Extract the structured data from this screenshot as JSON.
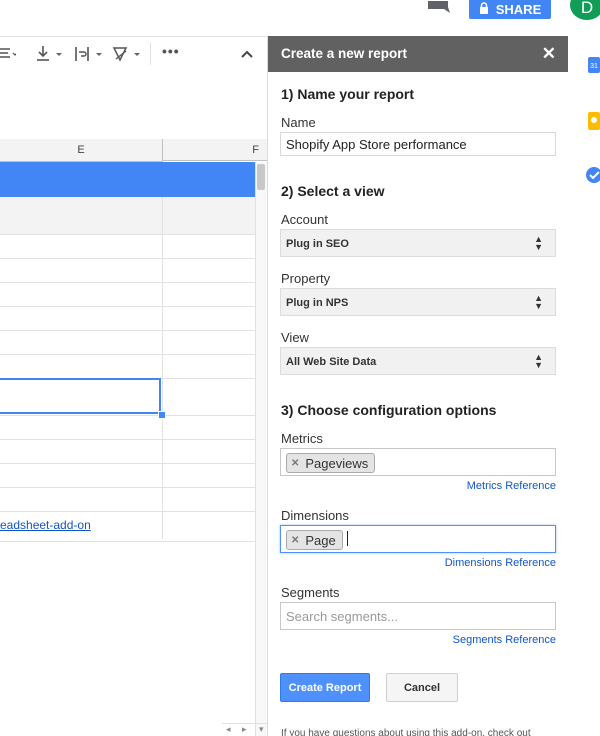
{
  "topbar": {
    "share_label": "SHARE",
    "avatar_initial": "D"
  },
  "grid": {
    "columns": [
      "E",
      "F"
    ],
    "link_text": "eadsheet-add-on"
  },
  "panel": {
    "title": "Create a new report",
    "section1": "1) Name your report",
    "name_label": "Name",
    "name_value": "Shopify App Store performance",
    "section2": "2) Select a view",
    "account_label": "Account",
    "account_value": "Plug in SEO",
    "property_label": "Property",
    "property_value": "Plug in NPS",
    "view_label": "View",
    "view_value": "All Web Site Data",
    "section3": "3) Choose configuration options",
    "metrics_label": "Metrics",
    "metrics_chip": "Pageviews",
    "metrics_ref": "Metrics Reference",
    "dimensions_label": "Dimensions",
    "dimensions_chip": "Page",
    "dimensions_ref": "Dimensions Reference",
    "segments_label": "Segments",
    "segments_placeholder": "Search segments...",
    "segments_ref": "Segments Reference",
    "create_button": "Create Report",
    "cancel_button": "Cancel",
    "footer_note": "If you have questions about using this add-on, check out"
  },
  "colors": {
    "accent": "#4285f4",
    "panel_header": "#616161",
    "link": "#1155cc",
    "selection": "#4285f4"
  }
}
